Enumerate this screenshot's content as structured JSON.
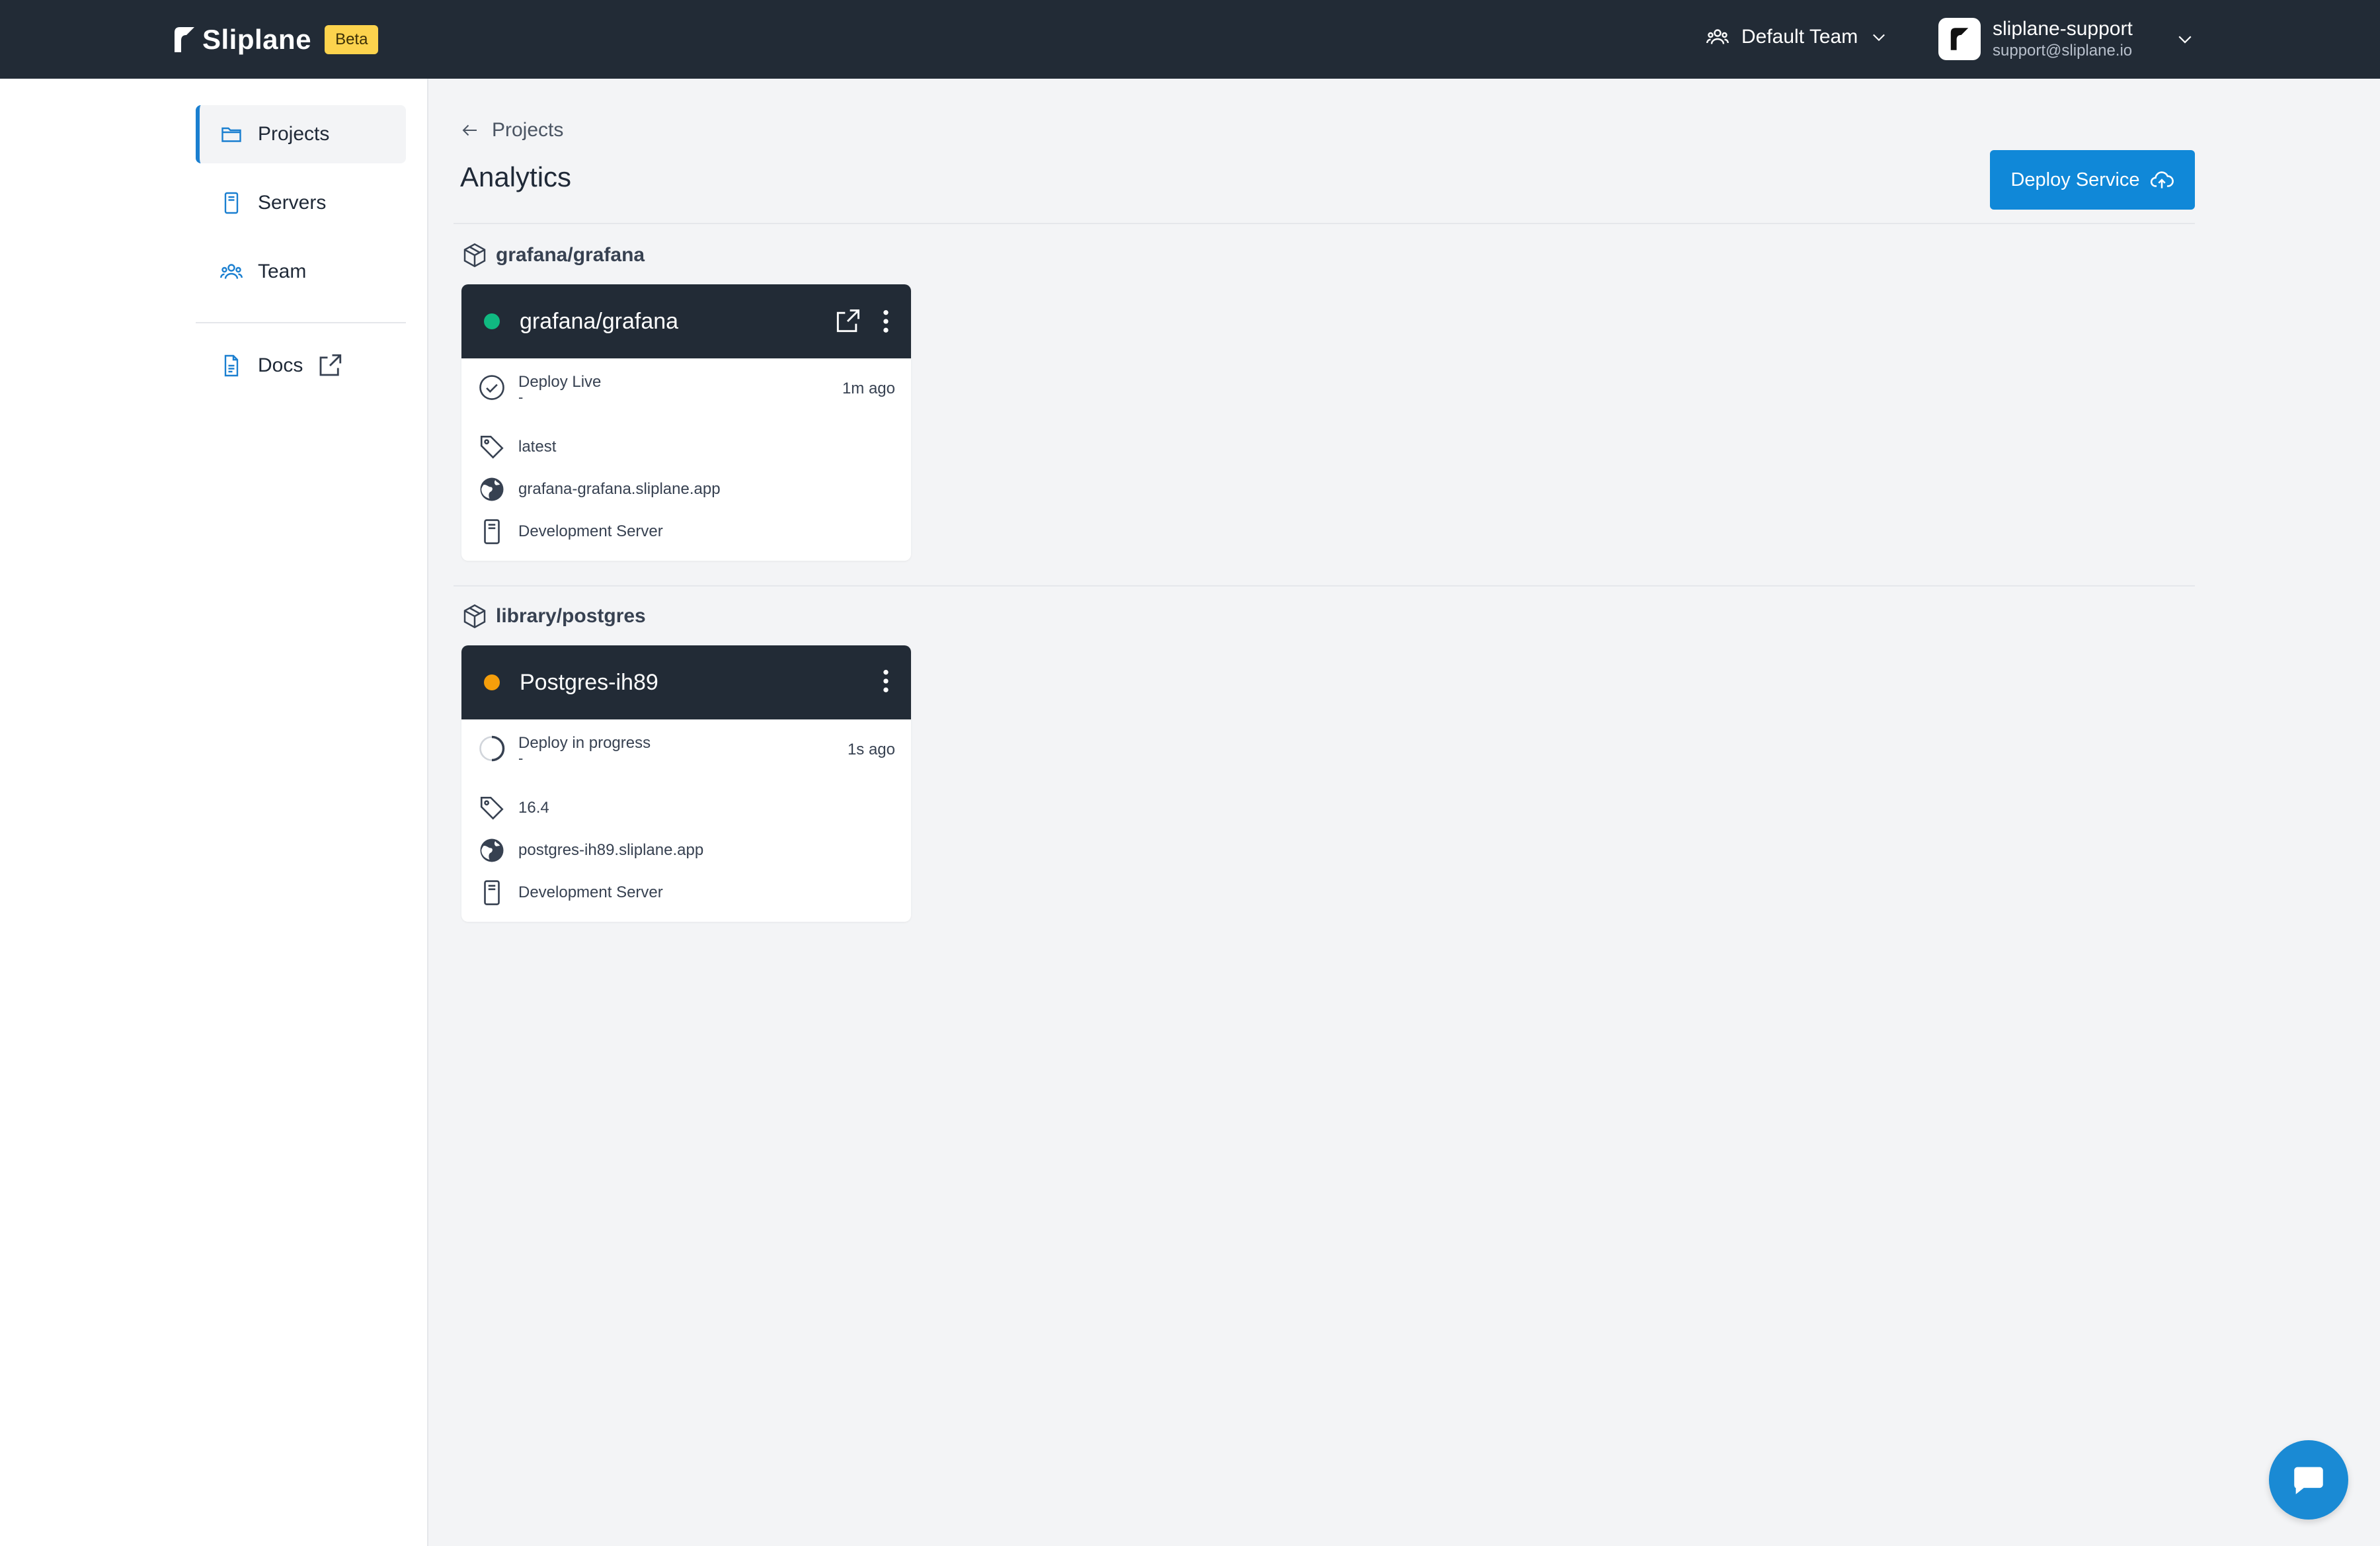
{
  "header": {
    "brand": "Sliplane",
    "badge": "Beta",
    "team": "Default Team",
    "user_name": "sliplane-support",
    "user_email": "support@sliplane.io"
  },
  "sidebar": {
    "items": [
      {
        "label": "Projects",
        "icon": "folder-icon",
        "active": true
      },
      {
        "label": "Servers",
        "icon": "server-icon",
        "active": false
      },
      {
        "label": "Team",
        "icon": "users-icon",
        "active": false
      }
    ],
    "docs": {
      "label": "Docs",
      "icon": "document-icon"
    }
  },
  "main": {
    "breadcrumb": "Projects",
    "title": "Analytics",
    "deploy_button": "Deploy Service",
    "groups": [
      {
        "name": "grafana/grafana",
        "service": {
          "name": "grafana/grafana",
          "status_color": "#10b981",
          "status": "Deploy Live",
          "status_sub": "-",
          "time": "1m ago",
          "tag": "latest",
          "domain": "grafana-grafana.sliplane.app",
          "server": "Development Server"
        }
      },
      {
        "name": "library/postgres",
        "service": {
          "name": "Postgres-ih89",
          "status_color": "#f59e0b",
          "status": "Deploy in progress",
          "status_sub": "-",
          "time": "1s ago",
          "tag": "16.4",
          "domain": "postgres-ih89.sliplane.app",
          "server": "Development Server"
        }
      }
    ]
  },
  "colors": {
    "header_bg": "#222b36",
    "accent": "#1088d8",
    "badge": "#fcd34d"
  }
}
